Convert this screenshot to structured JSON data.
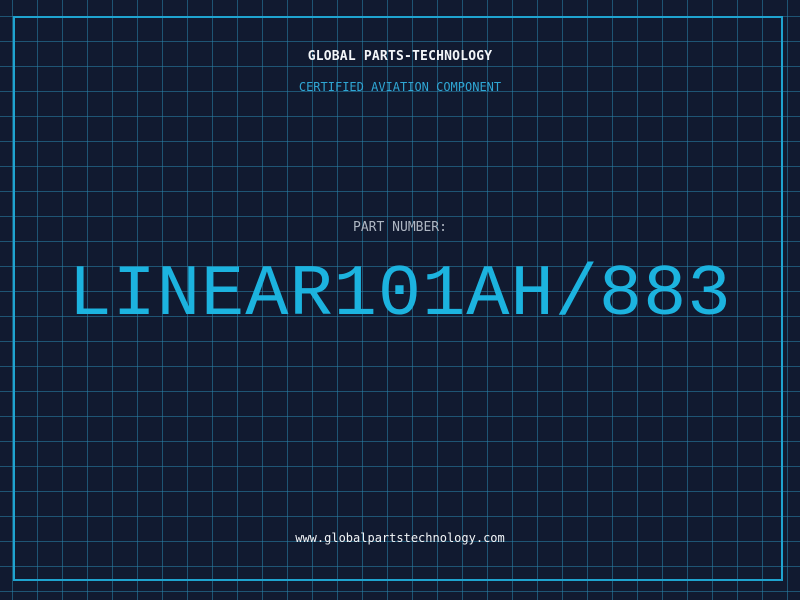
{
  "header": {
    "company": "GLOBAL PARTS-TECHNOLOGY",
    "subtitle": "CERTIFIED AVIATION COMPONENT"
  },
  "part": {
    "label": "PART NUMBER:",
    "number": "LINEAR101AH/883"
  },
  "footer": {
    "website": "www.globalpartstechnology.com"
  },
  "colors": {
    "background": "#111a30",
    "grid": "#2983aa",
    "accent": "#1cb3df",
    "text": "#f2f5f8",
    "muted": "#aeb6c2"
  }
}
